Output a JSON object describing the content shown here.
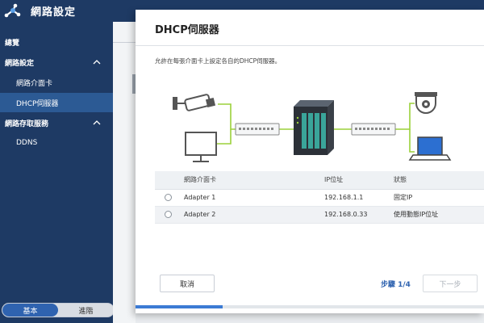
{
  "app": {
    "title": "網路設定"
  },
  "sidebar": {
    "items": [
      {
        "label": "總覽"
      },
      {
        "label": "網路設定"
      },
      {
        "label": "網路介面卡"
      },
      {
        "label": "DHCP伺服器"
      },
      {
        "label": "網路存取服務"
      },
      {
        "label": "DDNS"
      }
    ],
    "mode": {
      "basic": "基本",
      "advanced": "進階"
    }
  },
  "dialog": {
    "title": "DHCP伺服器",
    "description": "允許在每張介面卡上設定各自的DHCP伺服器。",
    "table": {
      "headers": [
        "網路介面卡",
        "IP位址",
        "狀態"
      ],
      "rows": [
        {
          "name": "Adapter 1",
          "ip": "192.168.1.1",
          "status": "固定IP"
        },
        {
          "name": "Adapter 2",
          "ip": "192.168.0.33",
          "status": "使用動態IP位址"
        }
      ]
    },
    "cancel_label": "取消",
    "step_label": "步驟 1/4",
    "next_label": "下一步",
    "progress": 0.25
  },
  "colors": {
    "sidebar_bg": "#1e3a64",
    "sidebar_active": "#2c5a94",
    "accent": "#2f63b0",
    "link_green": "#9bd13a",
    "nas_teal": "#3aa59a"
  },
  "icons": [
    "network-settings-icon",
    "chevron-up-icon",
    "security-camera-icon",
    "monitor-icon",
    "switch-icon",
    "nas-icon",
    "dome-camera-icon",
    "laptop-icon"
  ]
}
